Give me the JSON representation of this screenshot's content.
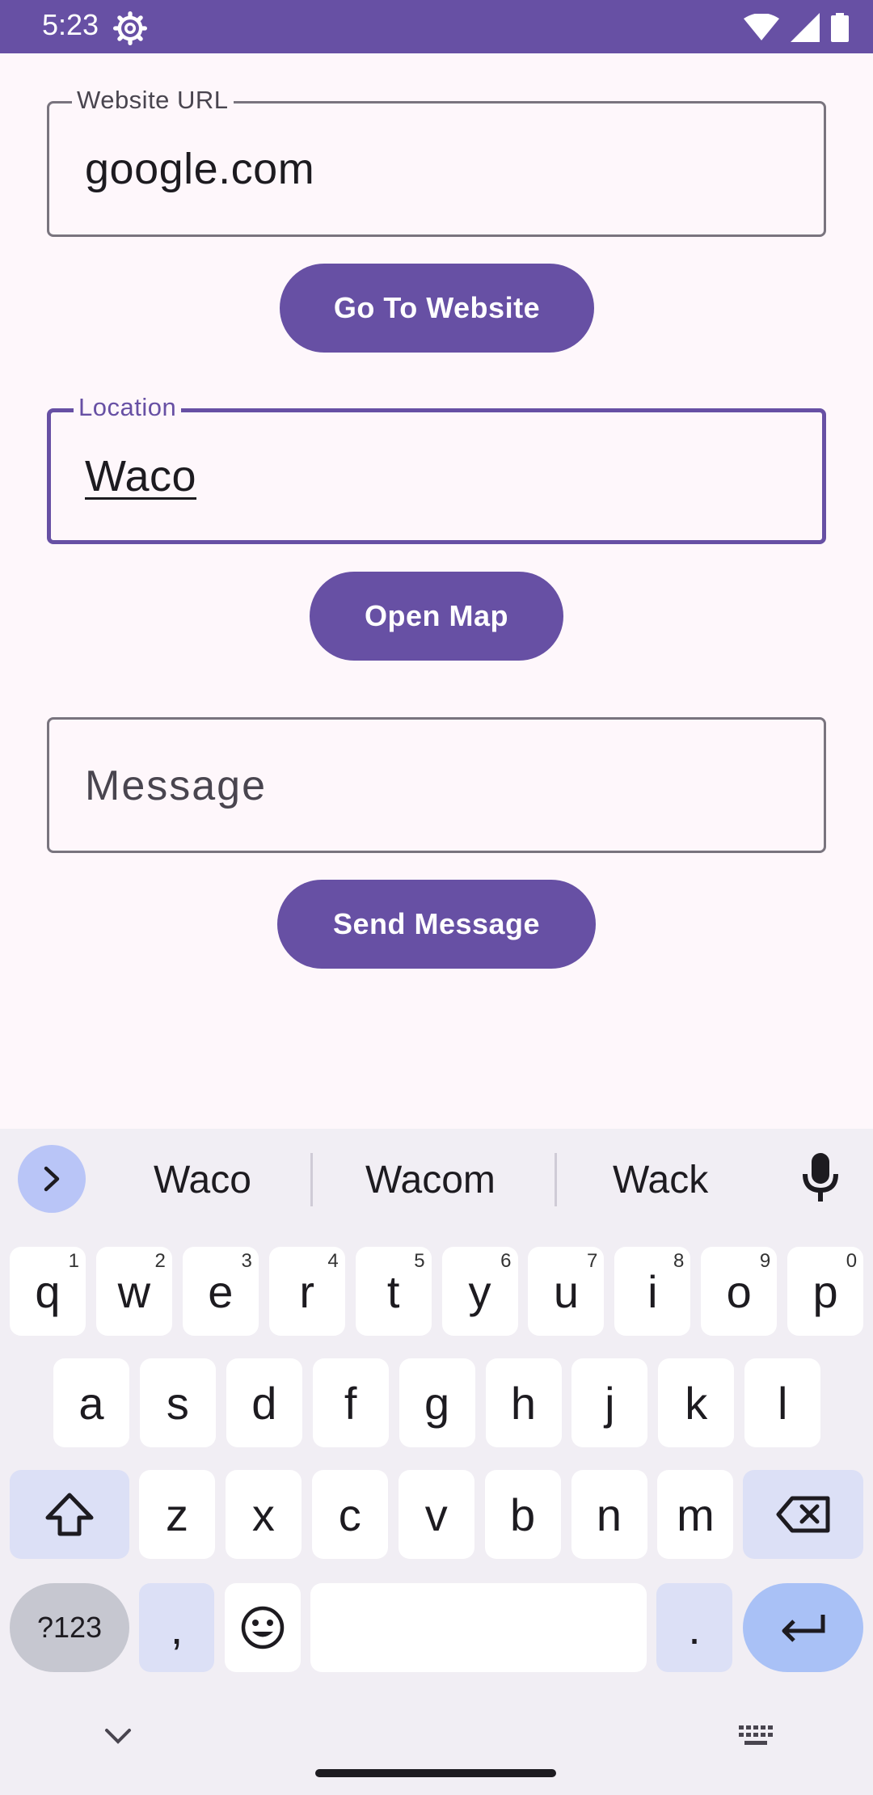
{
  "status_bar": {
    "time": "5:23",
    "color": "#6750a4"
  },
  "fields": {
    "website_url": {
      "label": "Website URL",
      "value": "google.com"
    },
    "location": {
      "label": "Location",
      "value": "Waco"
    },
    "message": {
      "placeholder": "Message"
    }
  },
  "buttons": {
    "go_to_website": "Go To Website",
    "open_map": "Open Map",
    "send_message": "Send Message"
  },
  "keyboard": {
    "suggestions": [
      "Waco",
      "Wacom",
      "Wack"
    ],
    "row1": [
      {
        "key": "q",
        "hint": "1"
      },
      {
        "key": "w",
        "hint": "2"
      },
      {
        "key": "e",
        "hint": "3"
      },
      {
        "key": "r",
        "hint": "4"
      },
      {
        "key": "t",
        "hint": "5"
      },
      {
        "key": "y",
        "hint": "6"
      },
      {
        "key": "u",
        "hint": "7"
      },
      {
        "key": "i",
        "hint": "8"
      },
      {
        "key": "o",
        "hint": "9"
      },
      {
        "key": "p",
        "hint": "0"
      }
    ],
    "row2": [
      "a",
      "s",
      "d",
      "f",
      "g",
      "h",
      "j",
      "k",
      "l"
    ],
    "row3": [
      "z",
      "x",
      "c",
      "v",
      "b",
      "n",
      "m"
    ],
    "symbols_label": "?123",
    "comma": ",",
    "period": "."
  }
}
